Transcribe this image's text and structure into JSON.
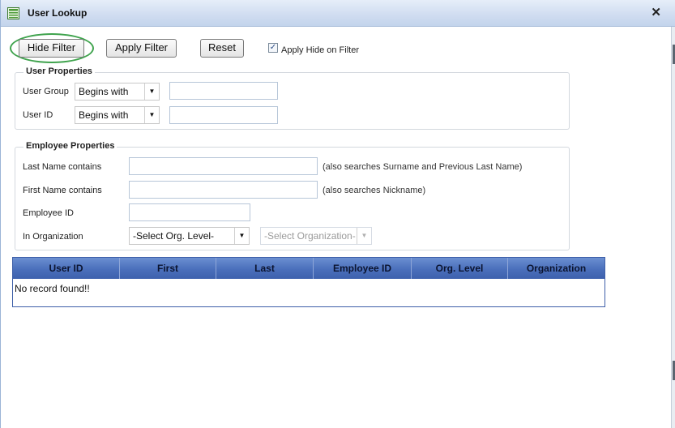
{
  "window": {
    "title": "User Lookup",
    "close_glyph": "✕"
  },
  "toolbar": {
    "hide_filter_label": "Hide Filter",
    "apply_filter_label": "Apply Filter",
    "reset_label": "Reset",
    "apply_hide_checkbox": {
      "checked": true,
      "label": "Apply Hide on Filter"
    }
  },
  "user_properties": {
    "legend": "User Properties",
    "user_group": {
      "label": "User Group",
      "operator": "Begins with",
      "value": ""
    },
    "user_id": {
      "label": "User ID",
      "operator": "Begins with",
      "value": ""
    }
  },
  "employee_properties": {
    "legend": "Employee Properties",
    "last_name": {
      "label": "Last Name contains",
      "value": "",
      "hint": "(also searches Surname and Previous Last Name)"
    },
    "first_name": {
      "label": "First Name contains",
      "value": "",
      "hint": "(also searches Nickname)"
    },
    "employee_id": {
      "label": "Employee ID",
      "value": ""
    },
    "organization": {
      "label": "In Organization",
      "level_selected": "-Select Org. Level-",
      "org_selected": "-Select Organization-"
    }
  },
  "results_grid": {
    "columns": [
      "User ID",
      "First",
      "Last",
      "Employee ID",
      "Org. Level",
      "Organization"
    ],
    "empty_message": "No record found!!"
  },
  "colors": {
    "highlight_ring": "#3fa34d",
    "grid_header": "#4a6fbb",
    "titlebar": "#cfdcf0"
  }
}
